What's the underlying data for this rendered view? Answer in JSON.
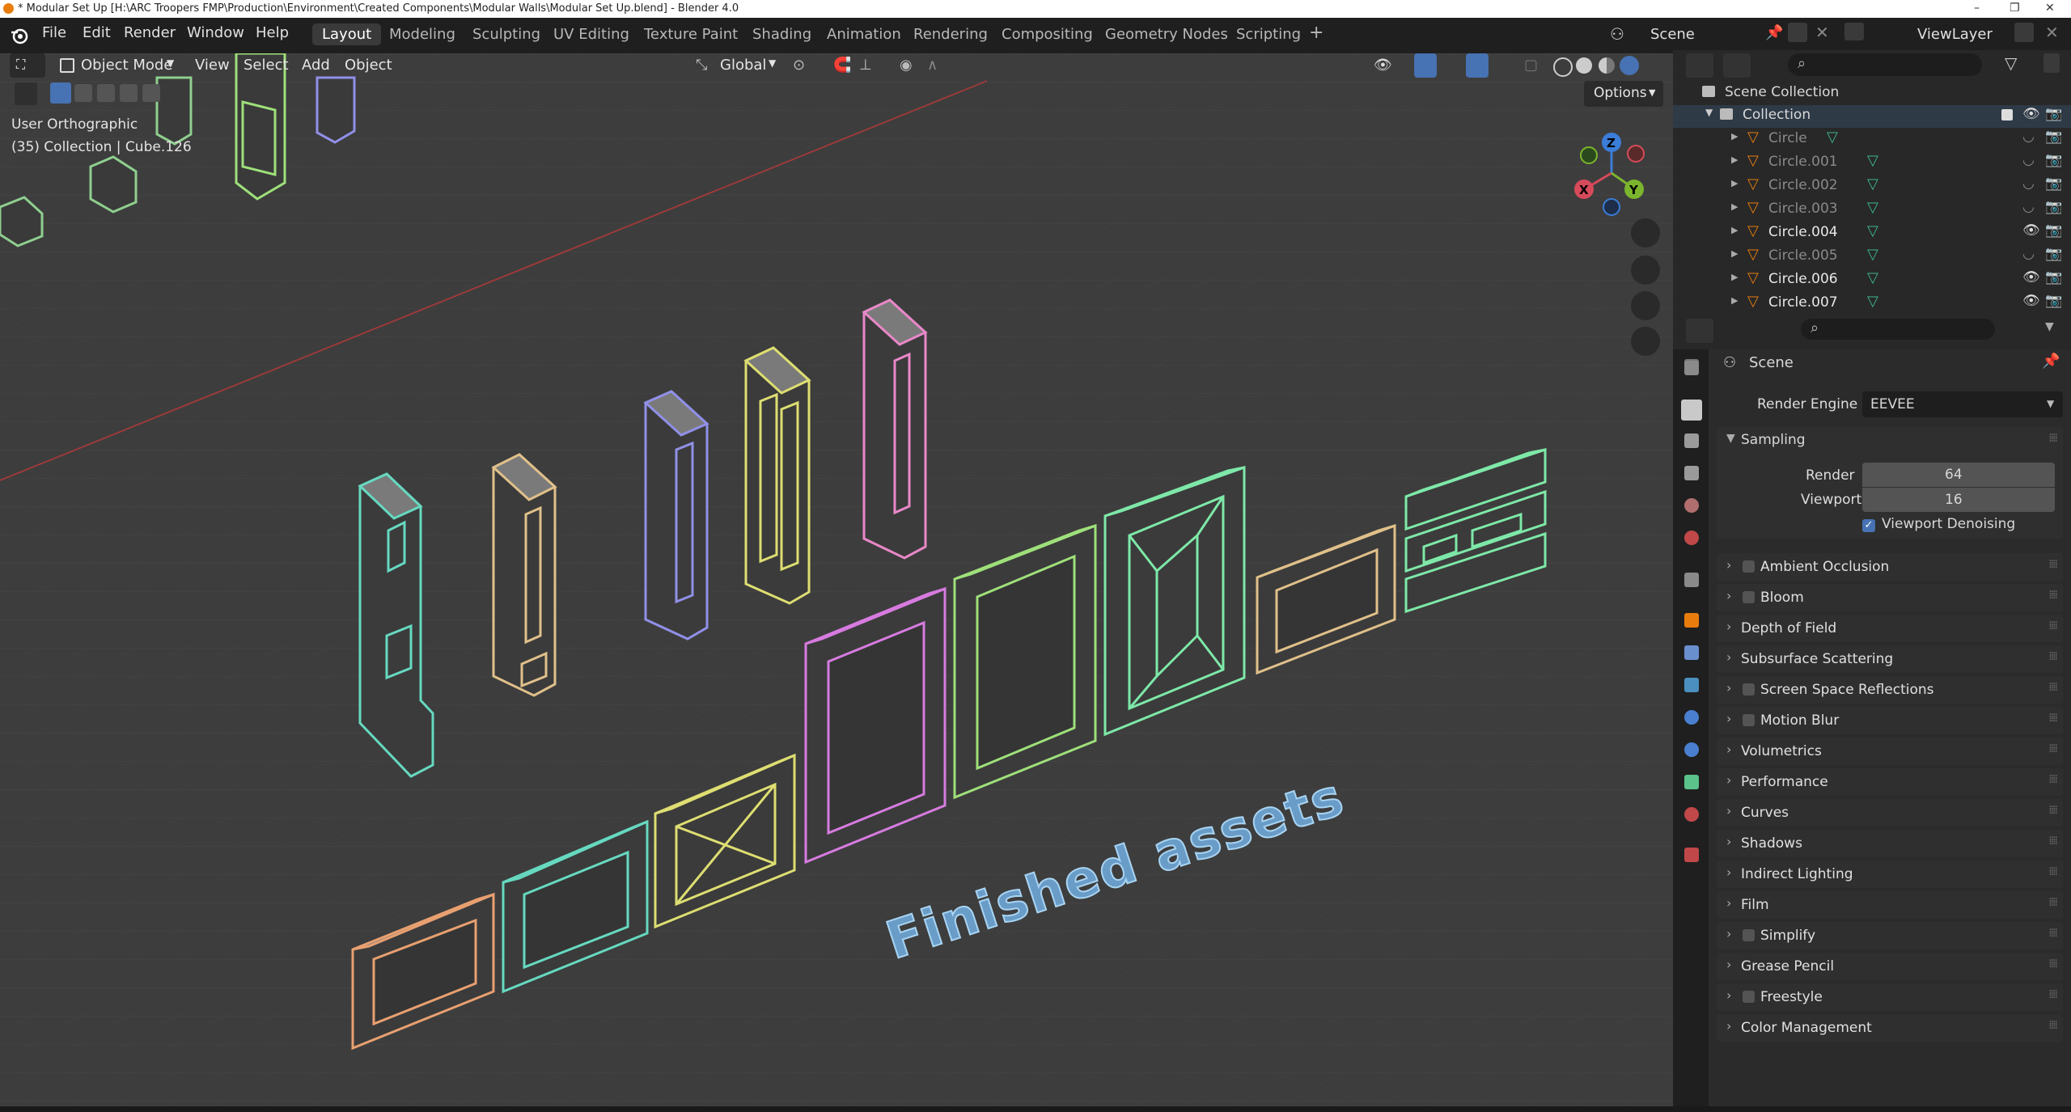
{
  "window": {
    "title": "* Modular Set Up [H:\\ARC Troopers FMP\\Production\\Environment\\Created Components\\Modular Walls\\Modular Set Up.blend] - Blender 4.0",
    "controls": [
      "–",
      "❐",
      "✕"
    ]
  },
  "menubar": {
    "items": [
      "File",
      "Edit",
      "Render",
      "Window",
      "Help"
    ]
  },
  "workspaces": {
    "tabs": [
      "Layout",
      "Modeling",
      "Sculpting",
      "UV Editing",
      "Texture Paint",
      "Shading",
      "Animation",
      "Rendering",
      "Compositing",
      "Geometry Nodes",
      "Scripting"
    ],
    "active": "Layout",
    "add": "+"
  },
  "scene_selector": {
    "value": "Scene"
  },
  "viewlayer_selector": {
    "value": "ViewLayer"
  },
  "viewport_header": {
    "mode": "Object Mode",
    "menus": [
      "View",
      "Select",
      "Add",
      "Object"
    ],
    "transform_orientation": "Global",
    "options": "Options"
  },
  "viewport_overlay": {
    "view_name": "User Orthographic",
    "context": "(35) Collection | Cube.126"
  },
  "gizmo": {
    "z": "Z",
    "x": "X",
    "y": "Y"
  },
  "scene_text_object": "Finished assets",
  "colors": {
    "accent_blue": "#4772b3",
    "mesh_orange": "#e8a070",
    "mesh_teal": "#66d9c0",
    "mesh_yellow": "#dede72",
    "mesh_magenta": "#d77be0",
    "mesh_green": "#9ee07a",
    "mesh_lightgreen": "#7ee8a8",
    "mesh_tan": "#e0c08a",
    "mesh_blue": "#9090e8",
    "mesh_pink": "#e888c8"
  },
  "outliner": {
    "root": "Scene Collection",
    "collection": "Collection",
    "items": [
      {
        "name": "Circle",
        "visible": false
      },
      {
        "name": "Circle.001",
        "visible": false
      },
      {
        "name": "Circle.002",
        "visible": false
      },
      {
        "name": "Circle.003",
        "visible": false
      },
      {
        "name": "Circle.004",
        "visible": true
      },
      {
        "name": "Circle.005",
        "visible": false
      },
      {
        "name": "Circle.006",
        "visible": true
      },
      {
        "name": "Circle.007",
        "visible": true
      }
    ]
  },
  "properties": {
    "context": "Scene",
    "render_engine_label": "Render Engine",
    "render_engine": "EEVEE",
    "sampling": {
      "title": "Sampling",
      "render_label": "Render",
      "render_value": "64",
      "viewport_label": "Viewport",
      "viewport_value": "16",
      "denoise_label": "Viewport Denoising",
      "denoise_checked": true
    },
    "panels": [
      {
        "label": "Ambient Occlusion",
        "checkbox": true
      },
      {
        "label": "Bloom",
        "checkbox": true
      },
      {
        "label": "Depth of Field",
        "checkbox": false
      },
      {
        "label": "Subsurface Scattering",
        "checkbox": false
      },
      {
        "label": "Screen Space Reflections",
        "checkbox": true
      },
      {
        "label": "Motion Blur",
        "checkbox": true
      },
      {
        "label": "Volumetrics",
        "checkbox": false
      },
      {
        "label": "Performance",
        "checkbox": false
      },
      {
        "label": "Curves",
        "checkbox": false
      },
      {
        "label": "Shadows",
        "checkbox": false
      },
      {
        "label": "Indirect Lighting",
        "checkbox": false
      },
      {
        "label": "Film",
        "checkbox": false
      },
      {
        "label": "Simplify",
        "checkbox": true
      },
      {
        "label": "Grease Pencil",
        "checkbox": false
      },
      {
        "label": "Freestyle",
        "checkbox": true
      },
      {
        "label": "Color Management",
        "checkbox": false
      }
    ]
  }
}
